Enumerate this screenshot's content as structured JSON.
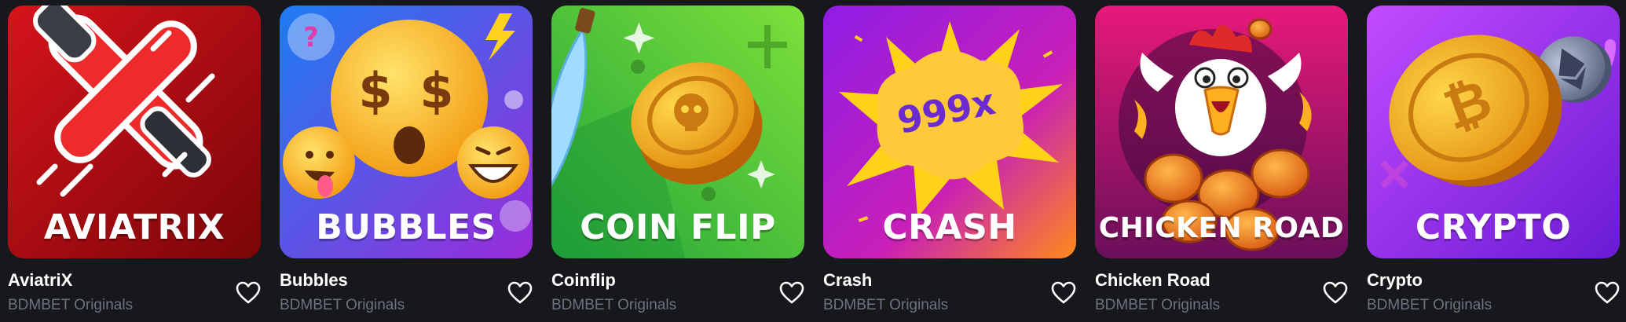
{
  "games": [
    {
      "title": "AviatriX",
      "provider": "BDMBET Originals",
      "thumb_label": "AVIATRIX",
      "icon": "airplane-icon",
      "bg": [
        "#d6141b",
        "#7a0508"
      ]
    },
    {
      "title": "Bubbles",
      "provider": "BDMBET Originals",
      "thumb_label": "BUBBLES",
      "icon": "money-face-emoji-icon",
      "bg": [
        "#1d7cf2",
        "#9b2bd9"
      ]
    },
    {
      "title": "Coinflip",
      "provider": "BDMBET Originals",
      "thumb_label": "COIN FLIP",
      "icon": "gold-coin-icon",
      "bg": [
        "#7ee03a",
        "#1fa43a"
      ]
    },
    {
      "title": "Crash",
      "provider": "BDMBET Originals",
      "thumb_label": "CRASH",
      "multiplier": "999x",
      "icon": "explosion-icon",
      "bg": [
        "#a21de0",
        "#ff7a18"
      ]
    },
    {
      "title": "Chicken Road",
      "provider": "BDMBET Originals",
      "thumb_label": "CHICKEN ROAD",
      "icon": "chicken-icon",
      "bg": [
        "#e8197a",
        "#6a0f5a"
      ]
    },
    {
      "title": "Crypto",
      "provider": "BDMBET Originals",
      "thumb_label": "CRYPTO",
      "icon": "bitcoin-coin-icon",
      "bg": [
        "#b93bff",
        "#6d1bd6"
      ]
    }
  ]
}
